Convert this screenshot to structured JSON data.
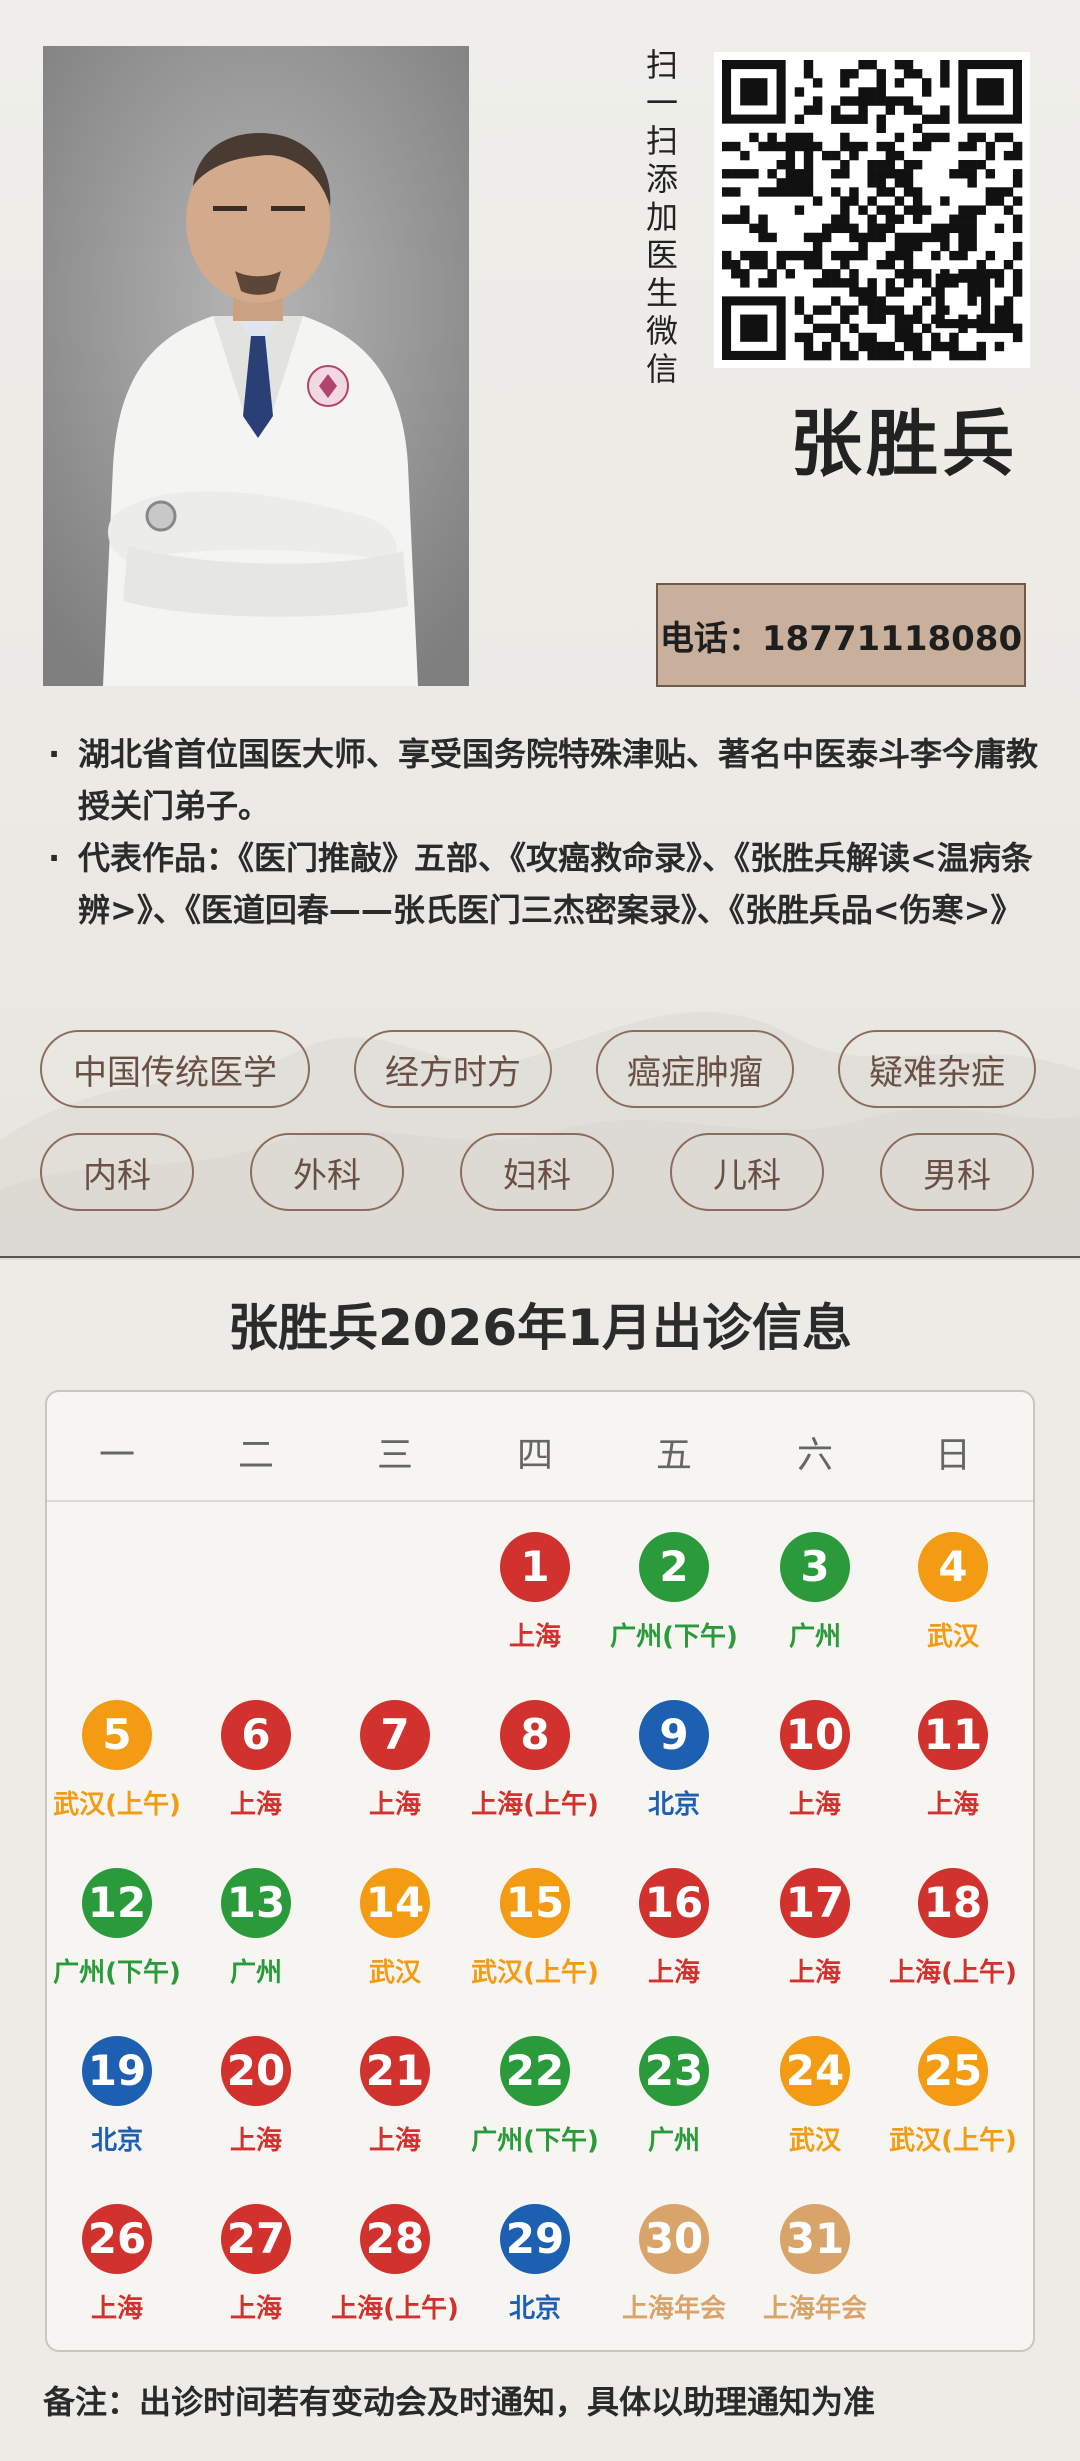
{
  "qr_label": [
    "扫",
    "一",
    "扫",
    "添",
    "加",
    "医",
    "生",
    "微",
    "信"
  ],
  "doctor_name": "张胜兵",
  "phone": "电话：18771118080",
  "intro": [
    "湖北省首位国医大师、享受国务院特殊津贴、著名中医泰斗李今庸教授关门弟子。",
    "代表作品：《医门推敲》五部、《攻癌救命录》、《张胜兵解读<温病条辨>》、《医道回春——张氏医门三杰密案录》、《张胜兵品<伤寒>》"
  ],
  "tags_row1": [
    "中国传统医学",
    "经方时方",
    "癌症肿瘤",
    "疑难杂症"
  ],
  "tags_row2": [
    "内科",
    "外科",
    "妇科",
    "儿科",
    "男科"
  ],
  "schedule_title": "张胜兵2026年1月出诊信息",
  "weekdays": [
    "一",
    "二",
    "三",
    "四",
    "五",
    "六",
    "日"
  ],
  "colors": {
    "red": "#d2322d",
    "green": "#2a9a3a",
    "orange": "#f39b12",
    "blue": "#1d5fb0",
    "tan": "#d9a46a"
  },
  "days": [
    {
      "n": "1",
      "loc": "上海",
      "color": "red"
    },
    {
      "n": "2",
      "loc": "广州(下午)",
      "color": "green"
    },
    {
      "n": "3",
      "loc": "广州",
      "color": "green"
    },
    {
      "n": "4",
      "loc": "武汉",
      "color": "orange"
    },
    {
      "n": "5",
      "loc": "武汉(上午)",
      "color": "orange"
    },
    {
      "n": "6",
      "loc": "上海",
      "color": "red"
    },
    {
      "n": "7",
      "loc": "上海",
      "color": "red"
    },
    {
      "n": "8",
      "loc": "上海(上午)",
      "color": "red"
    },
    {
      "n": "9",
      "loc": "北京",
      "color": "blue"
    },
    {
      "n": "10",
      "loc": "上海",
      "color": "red"
    },
    {
      "n": "11",
      "loc": "上海",
      "color": "red"
    },
    {
      "n": "12",
      "loc": "广州(下午)",
      "color": "green"
    },
    {
      "n": "13",
      "loc": "广州",
      "color": "green"
    },
    {
      "n": "14",
      "loc": "武汉",
      "color": "orange"
    },
    {
      "n": "15",
      "loc": "武汉(上午)",
      "color": "orange"
    },
    {
      "n": "16",
      "loc": "上海",
      "color": "red"
    },
    {
      "n": "17",
      "loc": "上海",
      "color": "red"
    },
    {
      "n": "18",
      "loc": "上海(上午)",
      "color": "red"
    },
    {
      "n": "19",
      "loc": "北京",
      "color": "blue"
    },
    {
      "n": "20",
      "loc": "上海",
      "color": "red"
    },
    {
      "n": "21",
      "loc": "上海",
      "color": "red"
    },
    {
      "n": "22",
      "loc": "广州(下午)",
      "color": "green"
    },
    {
      "n": "23",
      "loc": "广州",
      "color": "green"
    },
    {
      "n": "24",
      "loc": "武汉",
      "color": "orange"
    },
    {
      "n": "25",
      "loc": "武汉(上午)",
      "color": "orange"
    },
    {
      "n": "26",
      "loc": "上海",
      "color": "red"
    },
    {
      "n": "27",
      "loc": "上海",
      "color": "red"
    },
    {
      "n": "28",
      "loc": "上海(上午)",
      "color": "red"
    },
    {
      "n": "29",
      "loc": "北京",
      "color": "blue"
    },
    {
      "n": "30",
      "loc": "上海年会",
      "color": "tan"
    },
    {
      "n": "31",
      "loc": "上海年会",
      "color": "tan"
    }
  ],
  "note": "备注：出诊时间若有变动会及时通知，具体以助理通知为准"
}
